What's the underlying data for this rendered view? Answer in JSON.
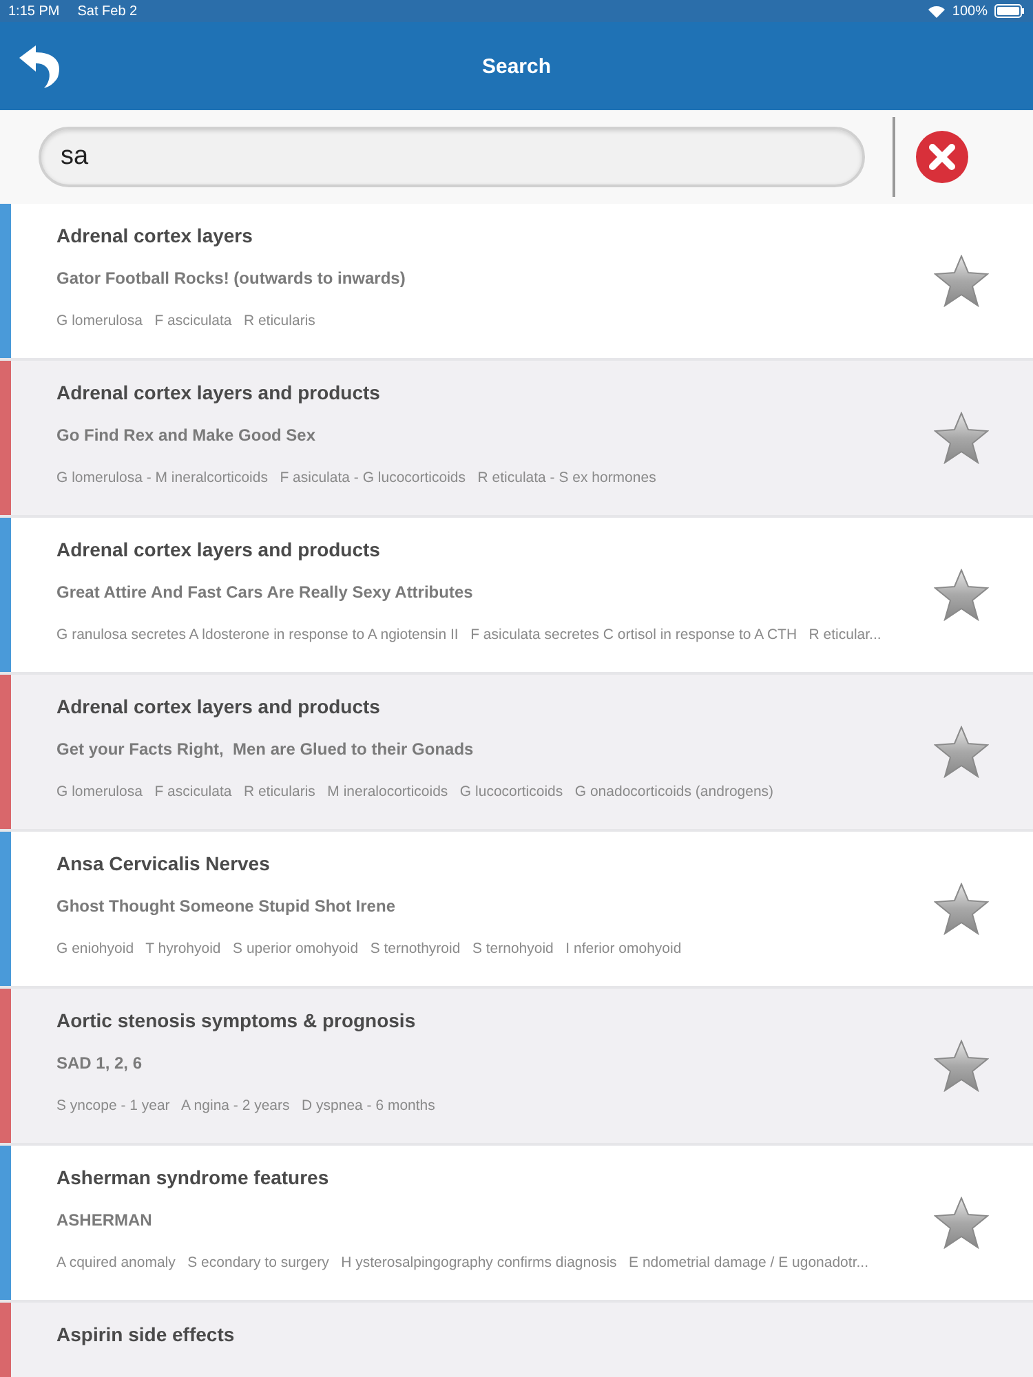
{
  "status_bar": {
    "time": "1:15 PM",
    "date": "Sat Feb 2",
    "battery": "100%"
  },
  "nav_bar": {
    "title": "Search"
  },
  "search": {
    "value": "sa"
  },
  "results": [
    {
      "title": "Adrenal cortex layers",
      "mnemonic": "Gator Football Rocks! (outwards to inwards)",
      "detail": "G lomerulosa   F asciculata   R eticularis",
      "color": "#4a9ad9",
      "starred": false
    },
    {
      "title": "Adrenal cortex layers and products",
      "mnemonic": "Go Find Rex and Make Good Sex",
      "detail": "G lomerulosa - M ineralcorticoids   F asiculata - G lucocorticoids   R eticulata - S ex hormones",
      "color": "#d9676b",
      "starred": false
    },
    {
      "title": "Adrenal cortex layers and products",
      "mnemonic": "Great Attire And Fast Cars Are Really Sexy Attributes",
      "detail": "G ranulosa secretes A ldosterone in response to A ngiotensin II   F asiculata secretes C ortisol in response to A CTH   R eticular...",
      "color": "#4a9ad9",
      "starred": false
    },
    {
      "title": "Adrenal cortex layers and products",
      "mnemonic": "Get your Facts Right,  Men are Glued to their Gonads",
      "detail": "G lomerulosa   F asciculata   R eticularis   M ineralocorticoids   G lucocorticoids   G onadocorticoids (androgens)",
      "color": "#d9676b",
      "starred": false
    },
    {
      "title": "Ansa Cervicalis Nerves",
      "mnemonic": "Ghost Thought Someone Stupid Shot Irene",
      "detail": "G eniohyoid   T hyrohyoid   S uperior omohyoid   S ternothyroid   S ternohyoid   I nferior omohyoid",
      "color": "#4a9ad9",
      "starred": false
    },
    {
      "title": "Aortic stenosis symptoms & prognosis",
      "mnemonic": "SAD 1, 2, 6",
      "detail": "S yncope - 1 year   A ngina - 2 years   D yspnea - 6 months",
      "color": "#d9676b",
      "starred": false
    },
    {
      "title": "Asherman syndrome features",
      "mnemonic": "ASHERMAN",
      "detail": "A cquired anomaly   S econdary to surgery   H ysterosalpingography confirms diagnosis   E ndometrial damage / E ugonadotr...",
      "color": "#4a9ad9",
      "starred": false
    },
    {
      "title": "Aspirin side effects",
      "color": "#d9676b"
    }
  ]
}
